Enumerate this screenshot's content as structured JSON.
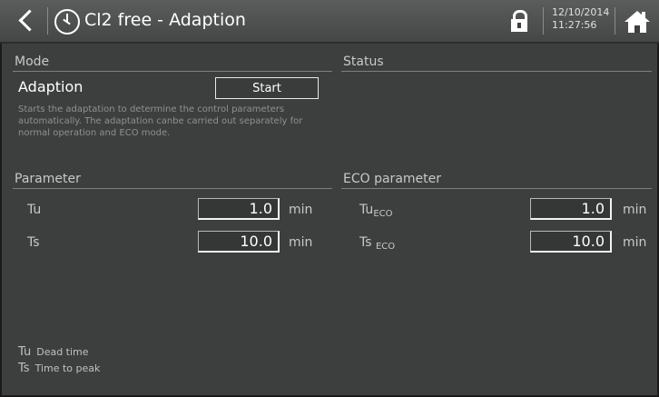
{
  "header": {
    "title": "Cl2 free - Adaption",
    "date": "12/10/2014",
    "time": "11:27:56"
  },
  "mode": {
    "title": "Mode",
    "adaption_label": "Adaption",
    "start_label": "Start",
    "description": "Starts the adaptation to determine the control parameters automatically. The adaptation canbe carried out separately for normal operation and ECO mode."
  },
  "status": {
    "title": "Status"
  },
  "parameter": {
    "title": "Parameter",
    "rows": [
      {
        "label": "Tu",
        "value": "1.0",
        "unit": "min"
      },
      {
        "label": "Ts",
        "value": "10.0",
        "unit": "min"
      }
    ]
  },
  "eco": {
    "title": "ECO parameter",
    "sub": "ECO",
    "rows": [
      {
        "label": "Tu",
        "value": "1.0",
        "unit": "min"
      },
      {
        "label": "Ts ",
        "value": "10.0",
        "unit": "min"
      }
    ]
  },
  "legend": [
    {
      "key": "Tu",
      "text": "Dead time"
    },
    {
      "key": "Ts",
      "text": "Time to peak"
    }
  ]
}
